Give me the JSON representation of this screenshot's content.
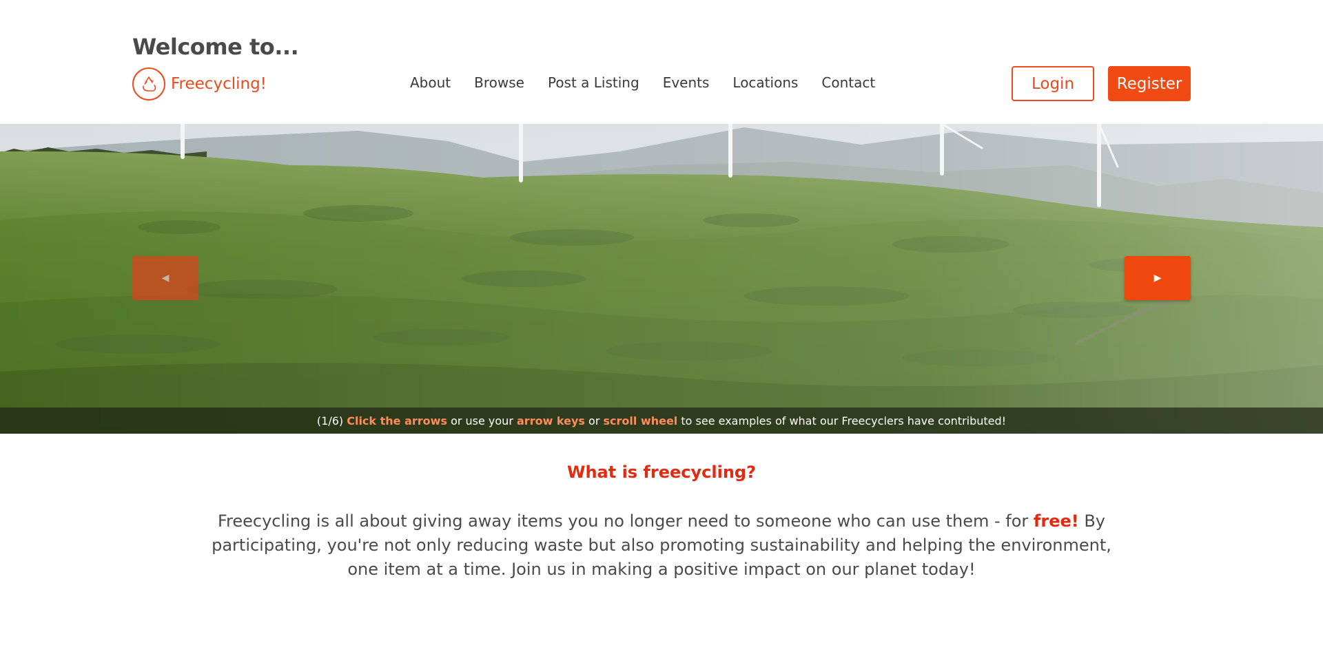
{
  "header": {
    "welcome": "Welcome to...",
    "logo_text": "Freecycling!",
    "logo_icon": "recycle-icon",
    "nav": [
      "About",
      "Browse",
      "Post a Listing",
      "Events",
      "Locations",
      "Contact"
    ],
    "login_label": "Login",
    "register_label": "Register"
  },
  "hero": {
    "prev_icon": "triangle-left-icon",
    "next_icon": "triangle-right-icon",
    "prev_glyph": "◀",
    "next_glyph": "▶",
    "caption": {
      "counter": "(1/6)",
      "hl1": "Click the arrows",
      "t1": "or use your",
      "hl2": "arrow keys",
      "t2": "or",
      "hl3": "scroll wheel",
      "t3": "to see examples of what our Freecyclers have contributed!"
    }
  },
  "intro": {
    "title": "What is freecycling?",
    "body_before": "Freecycling is all about giving away items you no longer need to someone who can use them - for",
    "body_free": "free!",
    "body_after": "By participating, you're not only reducing waste but also promoting sustainability and helping the environment, one item at a time. Join us in making a positive impact on our planet today!"
  },
  "colors": {
    "accent": "#f24a13",
    "heading_red": "#e4290f",
    "caption_highlight": "#ff8c5a"
  }
}
